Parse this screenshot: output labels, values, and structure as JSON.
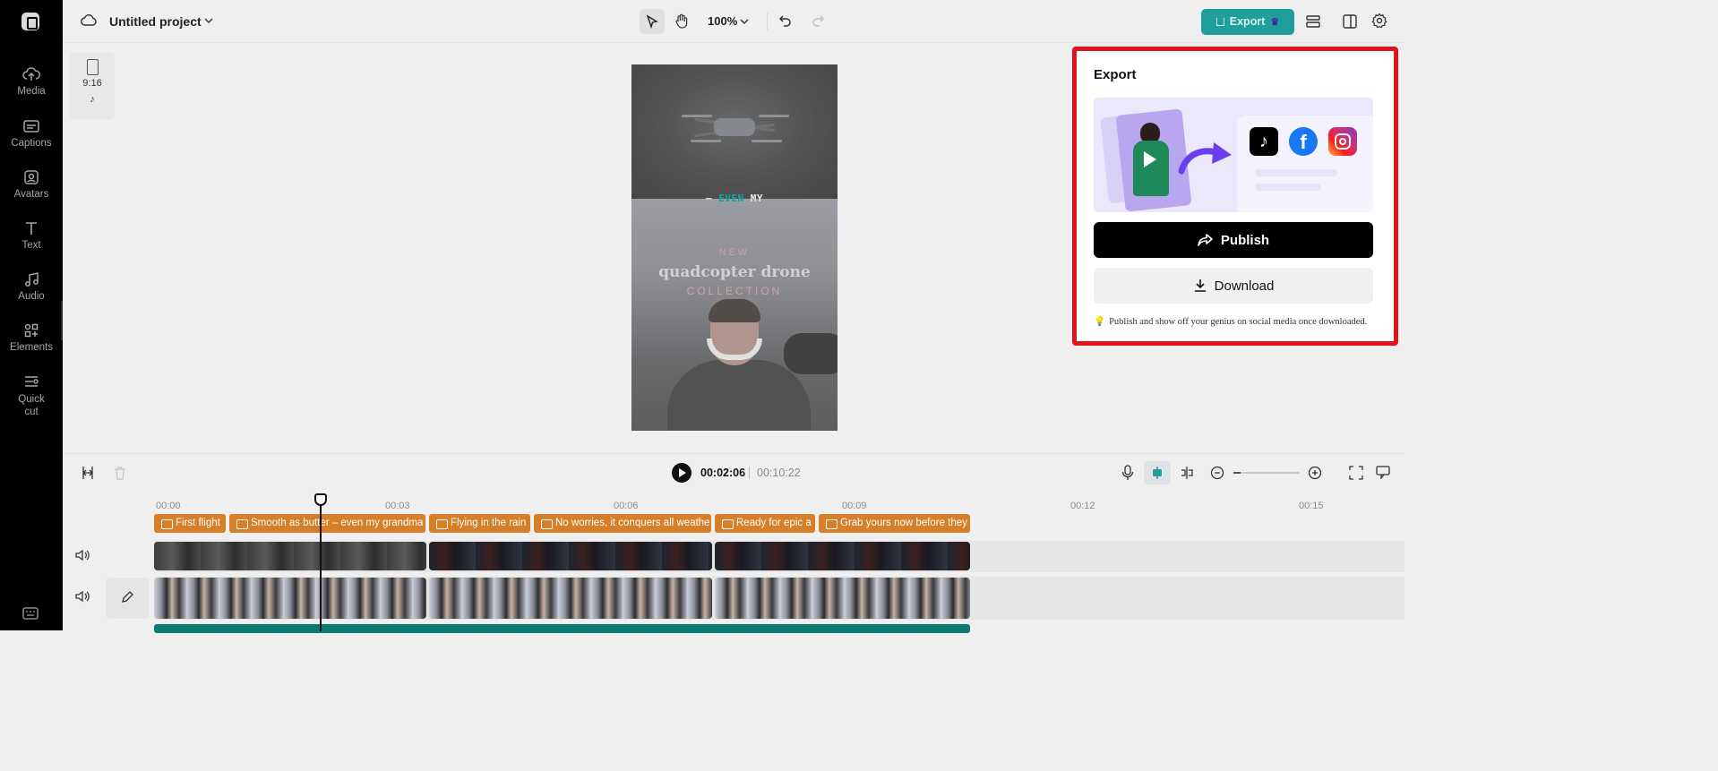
{
  "sidebar": {
    "items": [
      {
        "label": "Media",
        "icon": "cloud-upload-icon"
      },
      {
        "label": "Captions",
        "icon": "captions-icon"
      },
      {
        "label": "Avatars",
        "icon": "avatar-icon"
      },
      {
        "label": "Text",
        "icon": "text-icon"
      },
      {
        "label": "Audio",
        "icon": "music-note-icon"
      },
      {
        "label": "Elements",
        "icon": "elements-icon"
      },
      {
        "label": "Quick cut",
        "icon": "quick-cut-icon"
      }
    ]
  },
  "topbar": {
    "project_title": "Untitled project",
    "zoom": "100%",
    "export_label": "Export"
  },
  "stage": {
    "aspect_ratio": "9:16",
    "caption_words": {
      "pre": "– ",
      "highlight": "EVEN",
      "post": " MY"
    },
    "title_top": "NEW",
    "title_main": "quadcopter drone",
    "title_bottom": "COLLECTION"
  },
  "export_panel": {
    "title": "Export",
    "publish_label": "Publish",
    "download_label": "Download",
    "hint": "Publish and show off your genius on social media once downloaded."
  },
  "timeline": {
    "current_time": "00:02:06",
    "total_time": "00:10:22",
    "ruler": [
      "00:00",
      "00:03",
      "00:06",
      "00:09",
      "00:12",
      "00:15"
    ],
    "caption_clips": [
      "First flight",
      "Smooth as butter – even my grandma",
      "Flying in the rain",
      "No worries, it conquers all weathe",
      "Ready for epic a",
      "Grab yours now before they"
    ]
  },
  "colors": {
    "accent": "#1f9e9a",
    "highlight_border": "#e0141b",
    "caption_clip": "#d77f28"
  }
}
